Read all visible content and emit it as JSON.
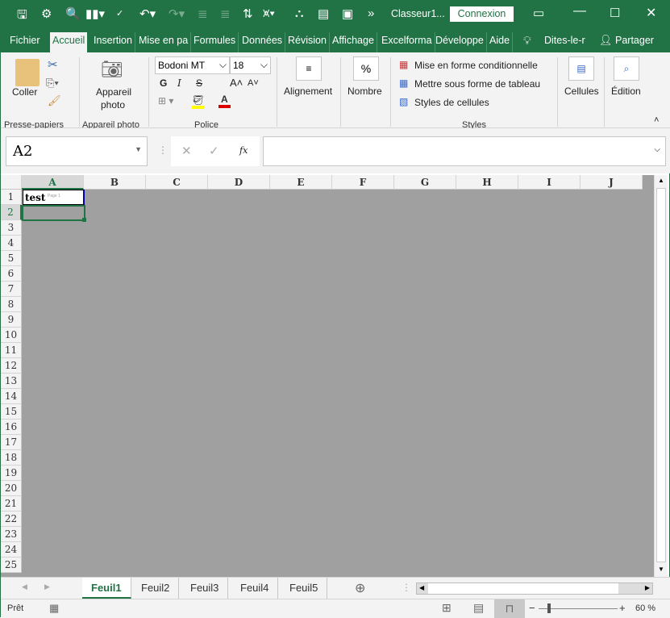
{
  "app": {
    "filename": "Classeur1...",
    "signin": "Connexion",
    "accent": "#217346"
  },
  "quick_access": [
    "save-icon",
    "touch-mode-icon",
    "print-preview-icon",
    "chart-icon",
    "spelling-icon",
    "undo-icon",
    "redo-icon",
    "indent-decrease-icon",
    "indent-increase-icon",
    "sort-icon",
    "filter-icon",
    "hierarchy-icon",
    "form-icon",
    "camera-icon",
    "more-icon"
  ],
  "tabs": [
    "Fichier",
    "Accueil",
    "Insertion",
    "Mise en pa",
    "Formules",
    "Données",
    "Révision",
    "Affichage",
    "Excelforma",
    "Développe",
    "Aide"
  ],
  "tell_me": "Dites-le-r",
  "share": "Partager",
  "ribbon": {
    "paste": "Coller",
    "clipboard_group": "Presse-papiers",
    "camera": "Appareil photo",
    "camera_line1": "Appareil",
    "camera_line2": "photo",
    "camera_group": "Appareil photo",
    "font_name": "Bodoni MT",
    "font_size": "18",
    "bold": "G",
    "italic": "I",
    "strike": "S",
    "font_group": "Police",
    "alignment": "Alignement",
    "number": "Nombre",
    "percent": "%",
    "cond_format": "Mise en forme conditionnelle",
    "table_format": "Mettre sous forme de tableau",
    "cell_styles": "Styles de cellules",
    "styles_group": "Styles",
    "cells": "Cellules",
    "editing": "Édition"
  },
  "formula_bar": {
    "name_box": "A2",
    "fx": "fx",
    "value": ""
  },
  "columns": [
    "A",
    "B",
    "C",
    "D",
    "E",
    "F",
    "G",
    "H",
    "I",
    "J"
  ],
  "rows": [
    "1",
    "2",
    "3",
    "4",
    "5",
    "6",
    "7",
    "8",
    "9",
    "10",
    "11",
    "12",
    "13",
    "14",
    "15",
    "16",
    "17",
    "18",
    "19",
    "20",
    "21",
    "22",
    "23",
    "24",
    "25"
  ],
  "cells": {
    "A1": "test",
    "A1_watermark": "Page 1"
  },
  "sheets": [
    "Feuil1",
    "Feuil2",
    "Feuil3",
    "Feuil4",
    "Feuil5"
  ],
  "active_sheet": "Feuil1",
  "status": {
    "ready": "Prêt",
    "zoom": "60 %",
    "zoom_value": 60
  }
}
